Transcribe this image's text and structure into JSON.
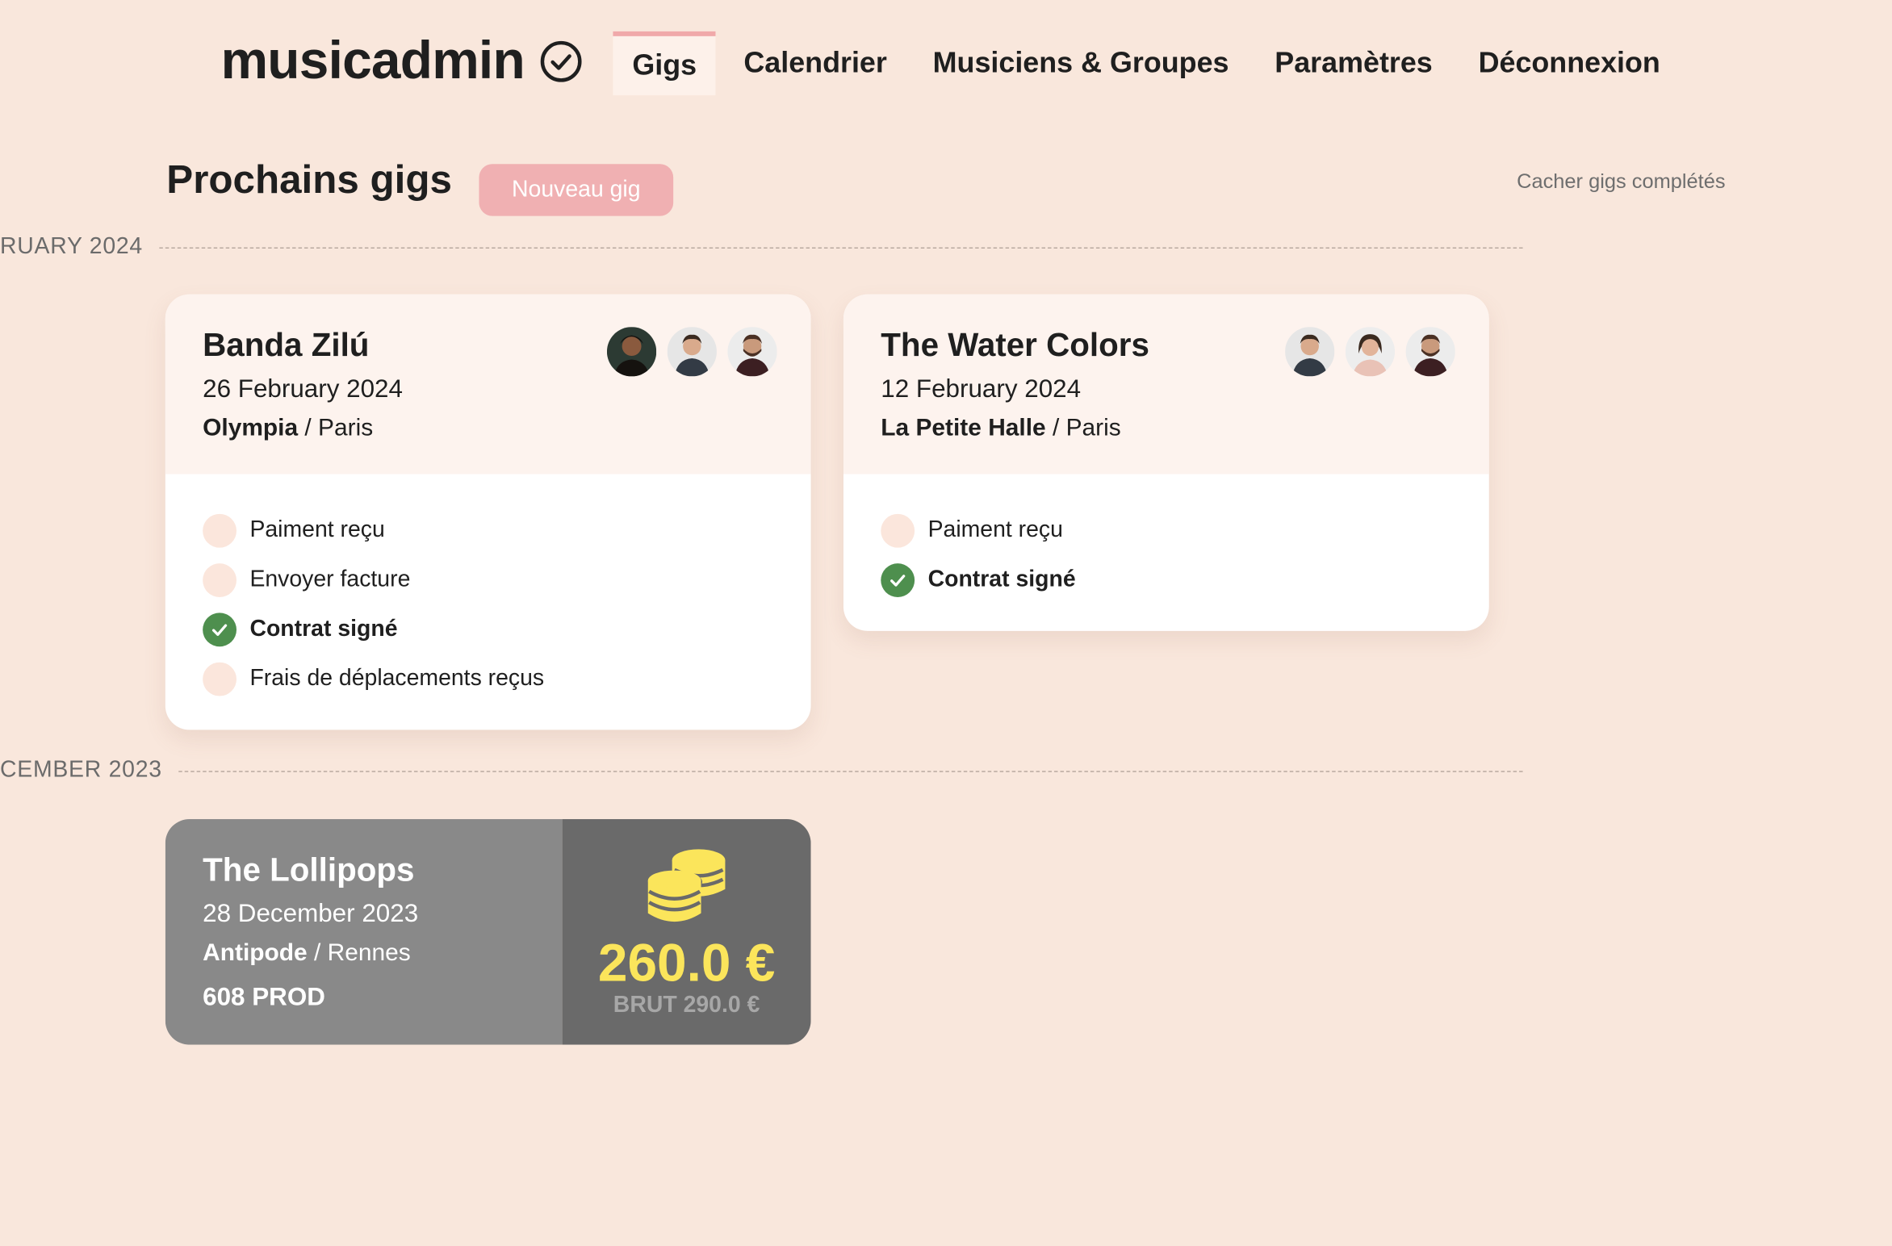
{
  "app": {
    "name": "musicadmin",
    "logo_icon": "check-circle-icon"
  },
  "nav": {
    "items": [
      {
        "label": "Gigs",
        "active": true
      },
      {
        "label": "Calendrier",
        "active": false
      },
      {
        "label": "Musiciens & Groupes",
        "active": false
      },
      {
        "label": "Paramètres",
        "active": false
      },
      {
        "label": "Déconnexion",
        "active": false
      }
    ]
  },
  "header": {
    "title": "Prochains gigs",
    "new_button": "Nouveau gig",
    "hide_completed": "Cacher gigs complétés"
  },
  "months": [
    {
      "label": "RUARY 2024"
    },
    {
      "label": "CEMBER 2023"
    }
  ],
  "gigs": [
    {
      "band": "Banda Zilú",
      "date": "26 February 2024",
      "venue": "Olympia",
      "city": " / Paris",
      "musicians": [
        "musician-avatar",
        "musician-avatar",
        "musician-avatar"
      ],
      "tasks": [
        {
          "label": "Paiment reçu",
          "done": false
        },
        {
          "label": "Envoyer facture",
          "done": false
        },
        {
          "label": "Contrat signé",
          "done": true
        },
        {
          "label": "Frais de déplacements reçus",
          "done": false
        }
      ]
    },
    {
      "band": "The Water Colors",
      "date": "12 February 2024",
      "venue": "La Petite Halle",
      "city": " / Paris",
      "musicians": [
        "musician-avatar",
        "musician-avatar",
        "musician-avatar"
      ],
      "tasks": [
        {
          "label": "Paiment reçu",
          "done": false
        },
        {
          "label": "Contrat signé",
          "done": true
        }
      ]
    }
  ],
  "paid_gig": {
    "band": "The Lollipops",
    "date": "28 December 2023",
    "venue": "Antipode",
    "city": " / Rennes",
    "organizer": "608 PROD",
    "net": "260.0 €",
    "gross": "BRUT 290.0 €",
    "icon": "coins-icon"
  },
  "colors": {
    "background": "#f9e7dc",
    "accent": "#f0b0b2",
    "done": "#4e8f4e",
    "amount": "#fbe55b"
  }
}
